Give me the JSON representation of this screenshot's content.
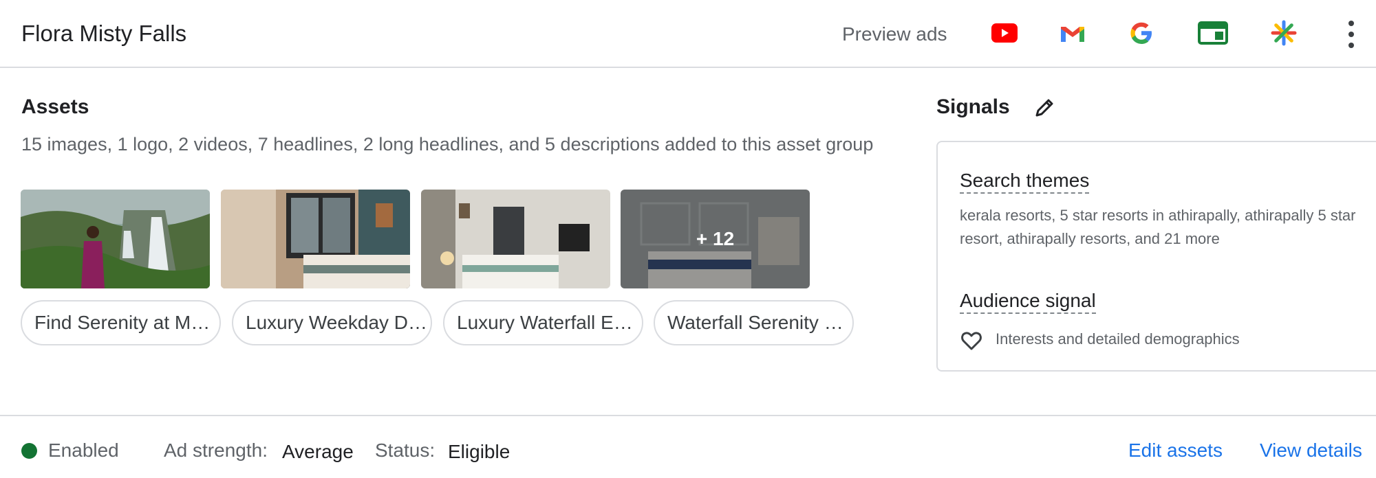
{
  "header": {
    "title": "Flora Misty Falls",
    "preview_label": "Preview ads",
    "channel_icons": [
      "youtube-icon",
      "gmail-icon",
      "google-icon",
      "display-icon",
      "discover-icon"
    ],
    "more_icon": "more-vert-icon"
  },
  "assets": {
    "heading": "Assets",
    "summary": "15 images, 1 logo, 2 videos, 7 headlines, 2 long headlines, and 5 descriptions added to this asset group",
    "thumbnails": [
      {
        "name": "thumb-waterfall"
      },
      {
        "name": "thumb-bedroom-1"
      },
      {
        "name": "thumb-bedroom-2"
      },
      {
        "name": "thumb-bedroom-3",
        "overlay": "+ 12"
      }
    ],
    "headline_chips": [
      "Find Serenity at M…",
      "Luxury Weekday D…",
      "Luxury Waterfall E…",
      "Waterfall Serenity …"
    ]
  },
  "signals": {
    "heading": "Signals",
    "search_themes_label": "Search themes",
    "search_themes_text": "kerala resorts, 5 star resorts in athirapally, athirapally 5 star resort, athirapally resorts, and 21 more",
    "audience_label": "Audience signal",
    "audience_text": "Interests and detailed demographics"
  },
  "footer": {
    "status_label": "Enabled",
    "ad_strength_label": "Ad strength:",
    "ad_strength_value": "Average",
    "status_field_label": "Status:",
    "status_field_value": "Eligible",
    "edit_link": "Edit assets",
    "view_link": "View details"
  },
  "colors": {
    "accent": "#1a73e8",
    "enabled": "#137333",
    "border": "#dadce0"
  }
}
